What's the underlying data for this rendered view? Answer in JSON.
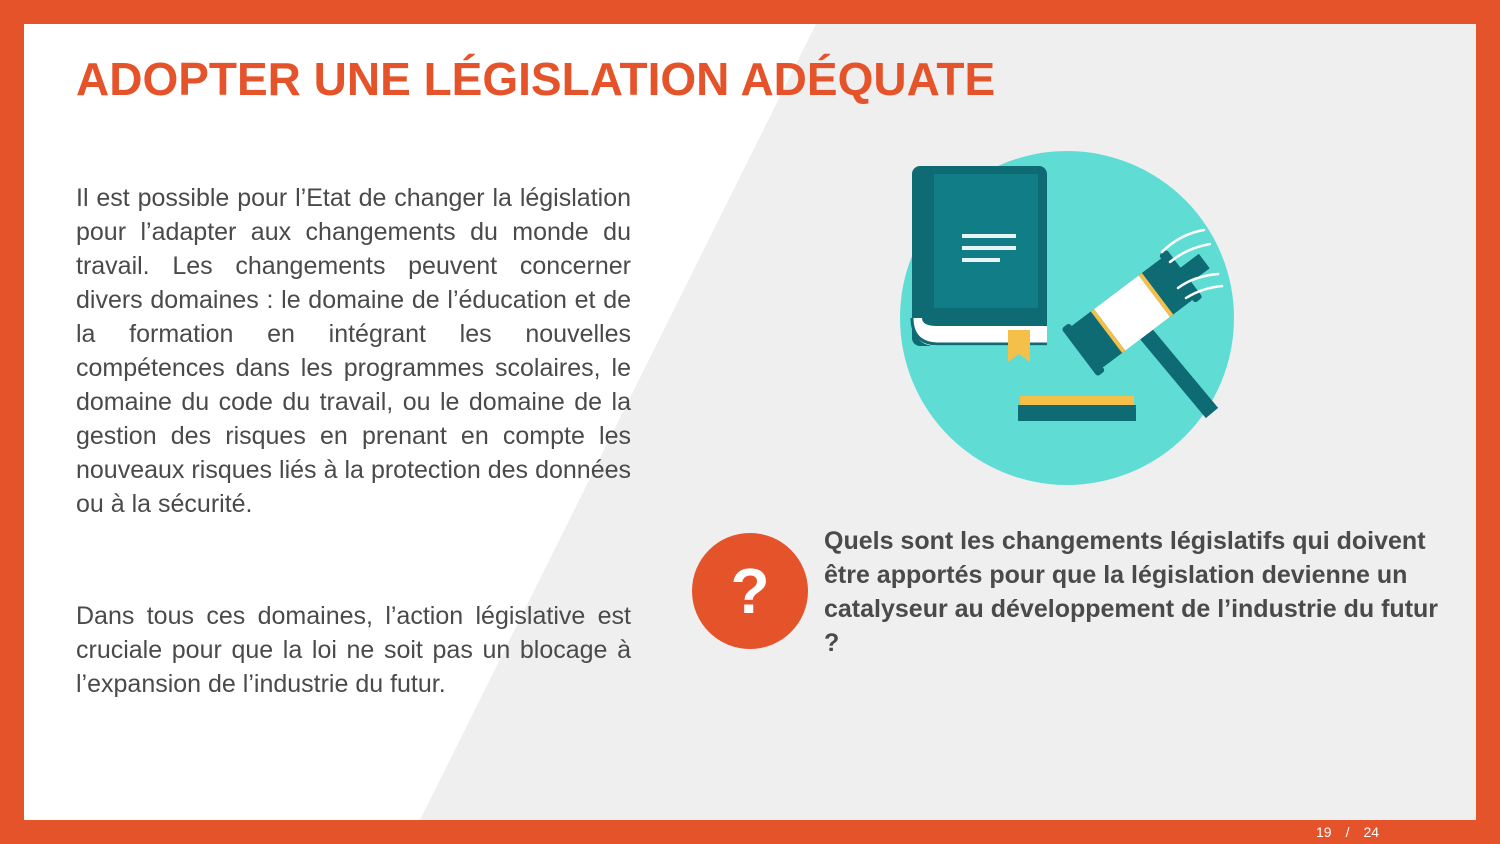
{
  "slide": {
    "title": "ADOPTER UNE LÉGISLATION ADÉQUATE",
    "paragraphs": [
      "Il est possible pour l’Etat de changer la législation pour l’adapter aux changements du monde du travail. Les changements peuvent concerner divers domaines : le domaine de l’éducation et de la formation en intégrant les nouvelles compétences dans les programmes scolaires, le domaine du code du travail, ou le domaine de la gestion des risques en prenant en compte les nouveaux risques liés à la protection des données ou à la sécurité.",
      "Dans tous ces domaines, l’action législative est cruciale pour que la loi ne soit pas un blocage à l’expansion de l’industrie du futur."
    ],
    "question": {
      "symbol": "?",
      "text": "Quels sont les changements législatifs qui doivent être apportés pour que la législation devienne un catalyseur au développement de l’industrie du futur ?"
    },
    "illustration_icon": "law-book-and-gavel-icon"
  },
  "pager": {
    "current": "19",
    "separator": "/",
    "total": "24"
  },
  "colors": {
    "accent": "#e5532a",
    "text": "#4a4a4a",
    "background_light": "#efefef",
    "teal_circle": "#5fddd5",
    "book_dark": "#0e6f78",
    "book_cover": "#117a84",
    "gold": "#f5c04a"
  }
}
